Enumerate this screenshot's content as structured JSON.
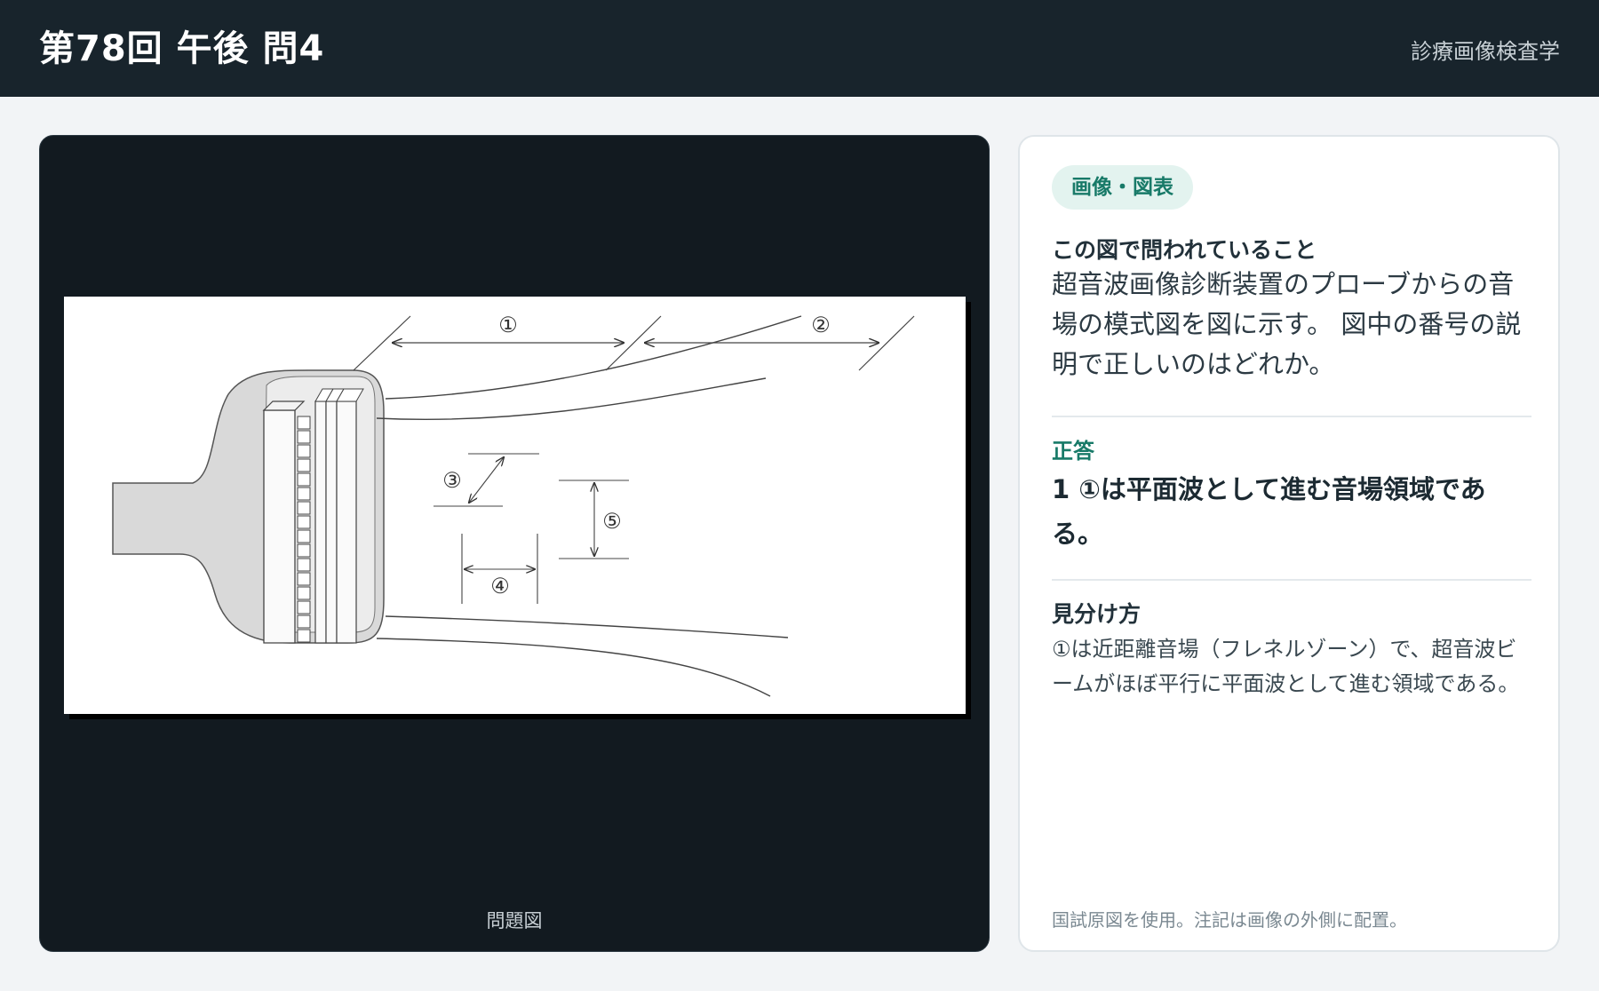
{
  "header": {
    "title": "第78回 午後 問4",
    "subject": "診療画像検査学"
  },
  "figure": {
    "caption": "問題図",
    "labels": [
      "①",
      "②",
      "③",
      "④",
      "⑤"
    ]
  },
  "info": {
    "tag": "画像・図表",
    "question_heading": "この図で問われていること",
    "question_text": "超音波画像診断装置のプローブからの音場の模式図を図に示す。 図中の番号の説明で正しいのはどれか。",
    "answer_label": "正答",
    "answer_text": "1 ①は平面波として進む音場領域である。",
    "tip_heading": "見分け方",
    "tip_text": "①は近距離音場（フレネルゾーン）で、超音波ビームがほぼ平行に平面波として進む領域である。",
    "footnote": "国試原図を使用。注記は画像の外側に配置。"
  }
}
